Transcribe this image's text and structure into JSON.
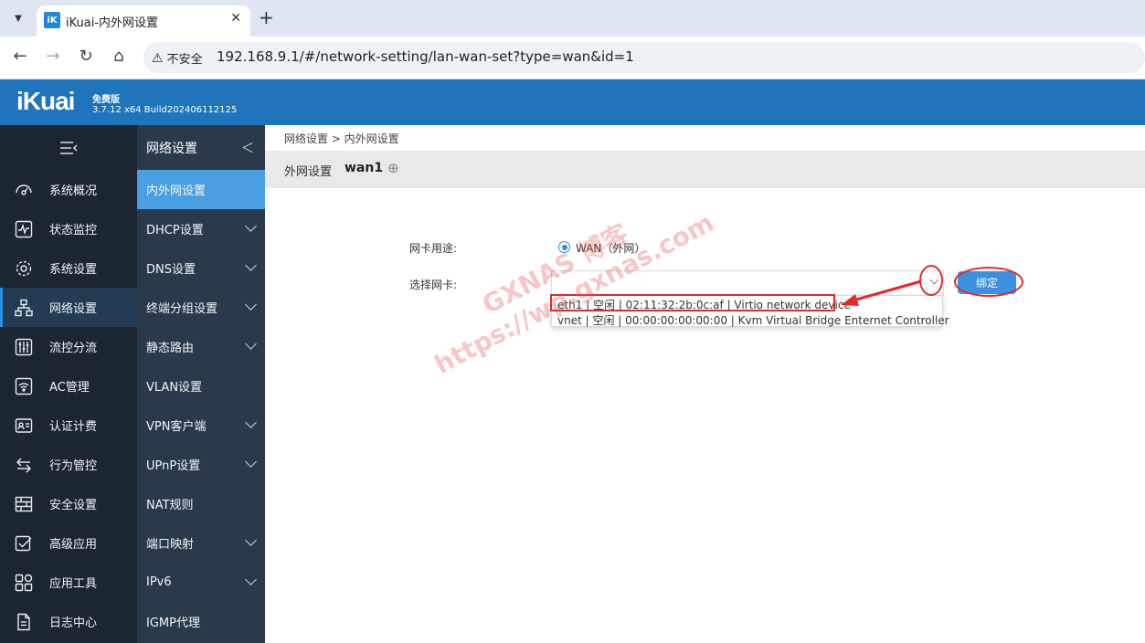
{
  "browser": {
    "tab_title": "iKuai-内外网设置",
    "tab_favicon": "iK",
    "security_warning": "不安全",
    "url": "192.168.9.1/#/network-setting/lan-wan-set?type=wan&id=1"
  },
  "header": {
    "logo": "iKuai",
    "edition": "免费版",
    "version": "3.7.12 x64 Build202406112125"
  },
  "sidebar_main": {
    "items": [
      {
        "label": "系统概况",
        "icon": "dashboard-icon"
      },
      {
        "label": "状态监控",
        "icon": "monitor-icon"
      },
      {
        "label": "系统设置",
        "icon": "gear-icon"
      },
      {
        "label": "网络设置",
        "icon": "network-icon",
        "active": true
      },
      {
        "label": "流控分流",
        "icon": "sliders-icon"
      },
      {
        "label": "AC管理",
        "icon": "wifi-icon"
      },
      {
        "label": "认证计费",
        "icon": "id-card-icon"
      },
      {
        "label": "行为管控",
        "icon": "arrows-icon"
      },
      {
        "label": "安全设置",
        "icon": "firewall-icon"
      },
      {
        "label": "高级应用",
        "icon": "check-box-icon"
      },
      {
        "label": "应用工具",
        "icon": "apps-icon"
      },
      {
        "label": "日志中心",
        "icon": "document-icon"
      }
    ]
  },
  "sidebar_sub": {
    "title": "网络设置",
    "items": [
      {
        "label": "内外网设置",
        "active": true,
        "expandable": false
      },
      {
        "label": "DHCP设置",
        "expandable": true
      },
      {
        "label": "DNS设置",
        "expandable": true
      },
      {
        "label": "终端分组设置",
        "expandable": true
      },
      {
        "label": "静态路由",
        "expandable": true
      },
      {
        "label": "VLAN设置",
        "expandable": false
      },
      {
        "label": "VPN客户端",
        "expandable": true
      },
      {
        "label": "UPnP设置",
        "expandable": true
      },
      {
        "label": "NAT规则",
        "expandable": false
      },
      {
        "label": "端口映射",
        "expandable": true
      },
      {
        "label": "IPv6",
        "expandable": true
      },
      {
        "label": "IGMP代理",
        "expandable": false
      }
    ]
  },
  "main": {
    "breadcrumb": "网络设置 > 内外网设置",
    "title_label": "外网设置",
    "title_name": "wan1",
    "form": {
      "nic_usage_label": "网卡用途:",
      "nic_usage_value": "WAN（外网）",
      "select_nic_label": "选择网卡:",
      "bind_button": "绑定",
      "options": [
        "eth1 | 空闲 | 02:11:32:2b:0c:af | Virtio network device",
        "vnet | 空闲 | 00:00:00:00:00:00 | Kvm Virtual Bridge Enternet Controller"
      ]
    }
  },
  "watermark": {
    "line1": "GXNAS 博客",
    "line2": "https://wp.gxnas.com"
  },
  "colors": {
    "header_blue": "#1f74bb",
    "sidebar_dark": "#1b2632",
    "sidebar_sub": "#2a3a4b",
    "active_blue": "#4aa0e3",
    "annotation_red": "#e3292c"
  }
}
